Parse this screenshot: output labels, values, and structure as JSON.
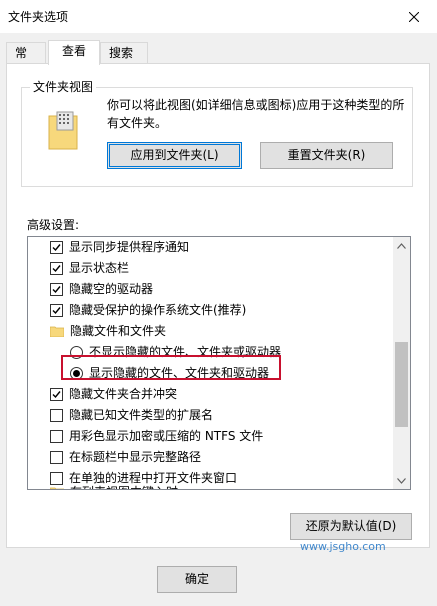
{
  "window": {
    "title": "文件夹选项"
  },
  "tabs": [
    {
      "label": "常规"
    },
    {
      "label": "查看"
    },
    {
      "label": "搜索"
    }
  ],
  "folder_view": {
    "group_label": "文件夹视图",
    "description": "你可以将此视图(如详细信息或图标)应用于这种类型的所有文件夹。",
    "apply_button": "应用到文件夹(L)",
    "reset_button": "重置文件夹(R)"
  },
  "advanced": {
    "label": "高级设置:",
    "items": [
      {
        "type": "checkbox",
        "checked": true,
        "label": "显示同步提供程序通知"
      },
      {
        "type": "checkbox",
        "checked": true,
        "label": "显示状态栏"
      },
      {
        "type": "checkbox",
        "checked": true,
        "label": "隐藏空的驱动器"
      },
      {
        "type": "checkbox",
        "checked": true,
        "label": "隐藏受保护的操作系统文件(推荐)"
      },
      {
        "type": "folder",
        "label": "隐藏文件和文件夹"
      },
      {
        "type": "radio",
        "checked": false,
        "label": "不显示隐藏的文件、文件夹或驱动器"
      },
      {
        "type": "radio",
        "checked": true,
        "label": "显示隐藏的文件、文件夹和驱动器"
      },
      {
        "type": "checkbox",
        "checked": true,
        "label": "隐藏文件夹合并冲突"
      },
      {
        "type": "checkbox",
        "checked": false,
        "label": "隐藏已知文件类型的扩展名"
      },
      {
        "type": "checkbox",
        "checked": false,
        "label": "用彩色显示加密或压缩的 NTFS 文件"
      },
      {
        "type": "checkbox",
        "checked": false,
        "label": "在标题栏中显示完整路径"
      },
      {
        "type": "checkbox",
        "checked": false,
        "label": "在单独的进程中打开文件夹窗口"
      },
      {
        "type": "folder",
        "label": "在列表视图中键入时"
      }
    ],
    "restore_button": "还原为默认值(D)"
  },
  "footer": {
    "ok_button": "确定"
  },
  "watermark": "www.jsgho.com",
  "colors": {
    "highlight": "#c8102e",
    "focus": "#0078d7"
  }
}
